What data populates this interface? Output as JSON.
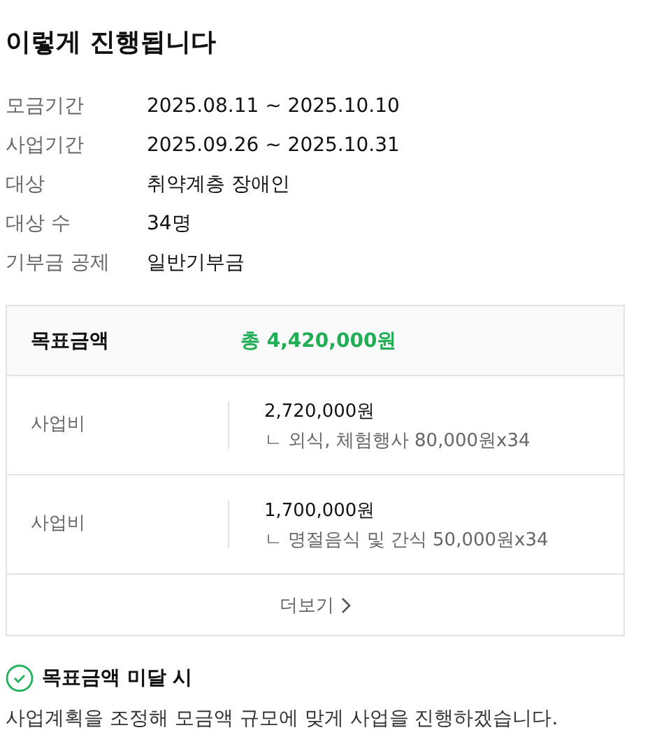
{
  "title": "이렇게 진행됩니다",
  "info": [
    {
      "label": "모금기간",
      "value": "2025.08.11 ~ 2025.10.10"
    },
    {
      "label": "사업기간",
      "value": "2025.09.26 ~ 2025.10.31"
    },
    {
      "label": "대상",
      "value": "취약계층 장애인"
    },
    {
      "label": "대상 수",
      "value": "34명"
    },
    {
      "label": "기부금 공제",
      "value": "일반기부금"
    }
  ],
  "budget": {
    "header_label": "목표금액",
    "total": "총 4,420,000원",
    "rows": [
      {
        "label": "사업비",
        "amount": "2,720,000원",
        "detail": "ㄴ 외식, 체험행사 80,000원x34"
      },
      {
        "label": "사업비",
        "amount": "1,700,000원",
        "detail": "ㄴ 명절음식 및 간식 50,000원x34"
      }
    ],
    "more": "더보기"
  },
  "notice": {
    "title": "목표금액 미달 시",
    "text": "사업계획을 조정해 모금액 규모에 맞게 사업을 진행하겠습니다."
  }
}
